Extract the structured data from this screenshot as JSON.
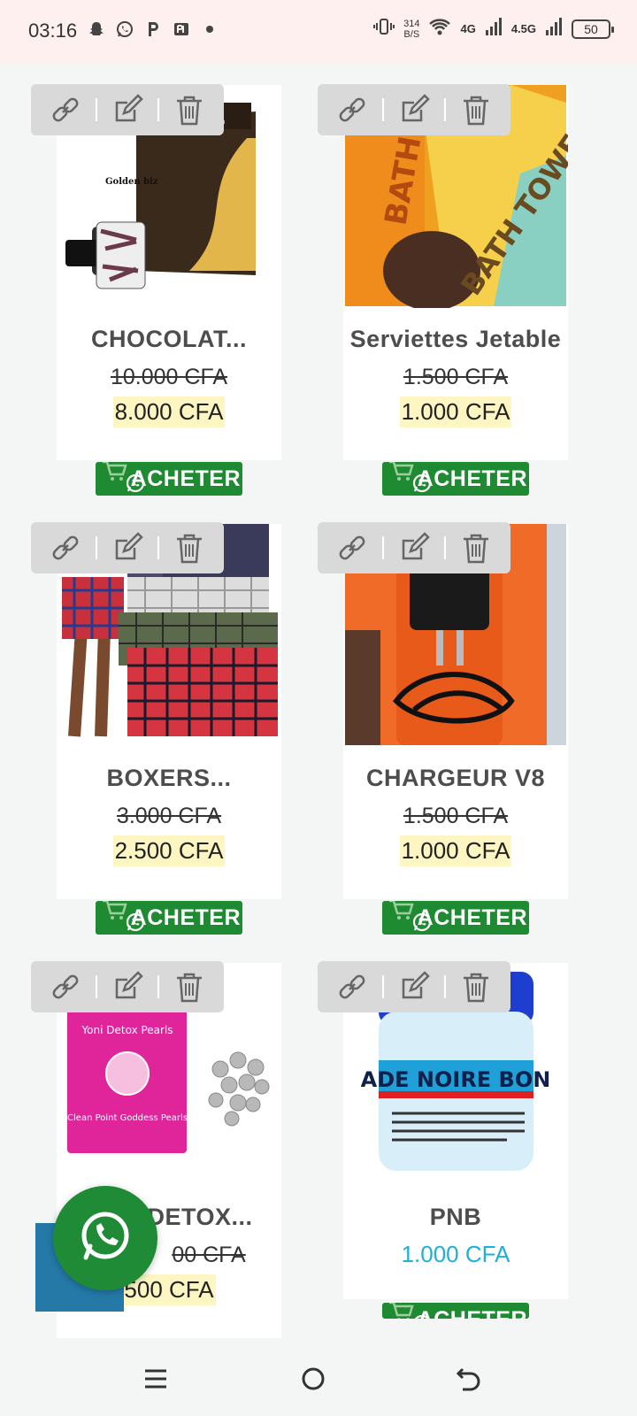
{
  "status_bar": {
    "time": "03:16",
    "notif_icons": [
      "snapchat-icon",
      "whatsapp-icon",
      "p-icon",
      "pr-icon",
      "dot-icon"
    ],
    "net_speed_value": "314",
    "net_speed_unit": "B/S",
    "net1": "4G",
    "net2": "4.5G",
    "battery": "50"
  },
  "buy_label": "ACHETER",
  "products": [
    {
      "name": "CHOCOLAT...",
      "old_price": "10.000 CFA",
      "new_price": "8.000 CFA",
      "image_text": "Golden biz"
    },
    {
      "name": "Serviettes Jetable",
      "old_price": "1.500 CFA",
      "new_price": "1.000 CFA",
      "image_text": "BATH TOWEL"
    },
    {
      "name": "BOXERS...",
      "old_price": "3.000 CFA",
      "new_price": "2.500 CFA"
    },
    {
      "name": "CHARGEUR V8",
      "old_price": "1.500 CFA",
      "new_price": "1.000 CFA"
    },
    {
      "name": "DETOX...",
      "old_price": "00 CFA",
      "new_price": "500 CFA",
      "image_text": "Yoni Detox Pearls",
      "image_subtext": "Clean Point Goddess Pearls"
    },
    {
      "name": "PNB",
      "price": "1.000 CFA",
      "image_text": "ADE NOIRE BON"
    }
  ],
  "colors": {
    "buy_button": "#1e8a31",
    "price_highlight": "#fdf6c3",
    "single_price": "#1fb0d8",
    "toolbar": "#d9d9d9"
  }
}
